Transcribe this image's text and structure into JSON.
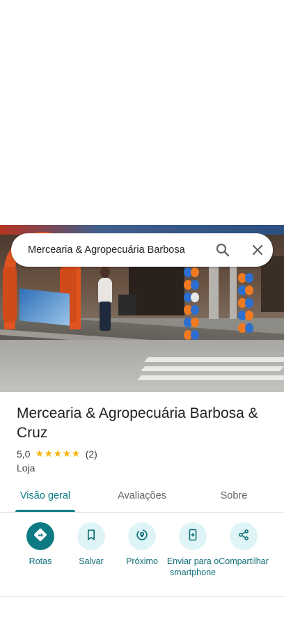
{
  "search": {
    "query": "Mercearia & Agropecuária Barbosa"
  },
  "place": {
    "title": "Mercearia & Agropecuária Barbosa & Cruz",
    "rating": "5,0",
    "stars": "★★★★★",
    "review_count": "(2)",
    "category": "Loja"
  },
  "tabs": [
    {
      "label": "Visão geral",
      "active": true
    },
    {
      "label": "Avaliações",
      "active": false
    },
    {
      "label": "Sobre",
      "active": false
    }
  ],
  "actions": [
    {
      "label": "Rotas",
      "icon": "directions-icon"
    },
    {
      "label": "Salvar",
      "icon": "bookmark-icon"
    },
    {
      "label": "Próximo",
      "icon": "nearby-icon"
    },
    {
      "label": "Enviar para o smartphone",
      "icon": "send-to-phone-icon"
    },
    {
      "label": "Compartilhar",
      "icon": "share-icon"
    }
  ],
  "colors": {
    "accent": "#0e7b84",
    "action_bg": "#dff4f6",
    "star": "#f4b400"
  }
}
